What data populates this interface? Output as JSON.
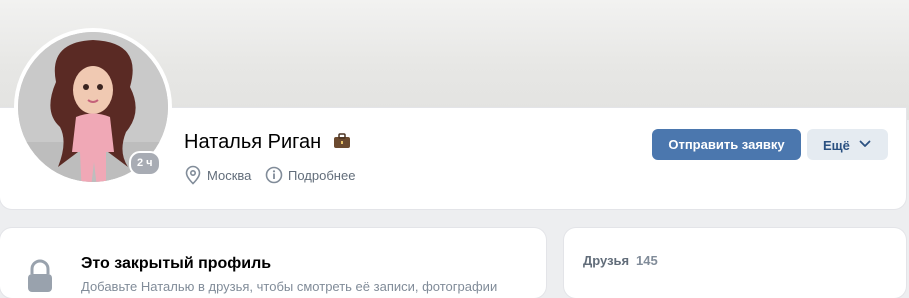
{
  "profile": {
    "name": "Наталья Риган",
    "online_badge": "2 ч",
    "city": "Москва",
    "details_label": "Подробнее",
    "send_request_label": "Отправить заявку",
    "more_label": "Ещё"
  },
  "closed_profile": {
    "title": "Это закрытый профиль",
    "description": "Добавьте Наталью в друзья, чтобы смотреть её записи, фотографии"
  },
  "friends": {
    "label": "Друзья",
    "count": "145"
  },
  "icons": {
    "verified_badge": "briefcase-icon",
    "location": "location-pin-icon",
    "info": "info-icon",
    "more_dropdown": "chevron-down-icon",
    "closed_profile": "lock-icon"
  },
  "colors": {
    "primary_button": "#4b77ae",
    "secondary_button_bg": "#e5ebf1",
    "secondary_button_text": "#2b5181",
    "muted_text": "#626d7a"
  }
}
